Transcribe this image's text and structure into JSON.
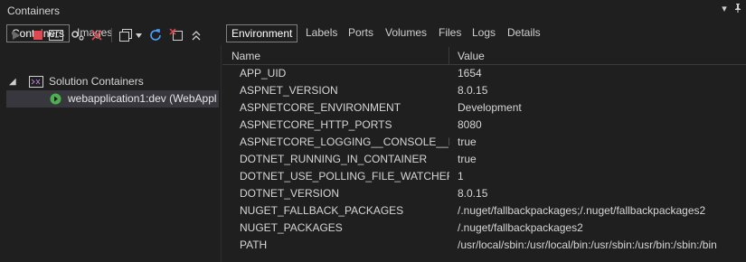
{
  "window": {
    "title": "Containers"
  },
  "left_tabs": [
    {
      "label": "Containers"
    },
    {
      "label": "Images"
    }
  ],
  "tree": {
    "root": "Solution Containers",
    "child": "webapplication1:dev (WebAppl"
  },
  "right_tabs": [
    {
      "label": "Environment"
    },
    {
      "label": "Labels"
    },
    {
      "label": "Ports"
    },
    {
      "label": "Volumes"
    },
    {
      "label": "Files"
    },
    {
      "label": "Logs"
    },
    {
      "label": "Details"
    }
  ],
  "grid": {
    "columns": {
      "name": "Name",
      "value": "Value"
    },
    "rows": [
      {
        "name": "APP_UID",
        "value": "1654"
      },
      {
        "name": "ASPNET_VERSION",
        "value": "8.0.15"
      },
      {
        "name": "ASPNETCORE_ENVIRONMENT",
        "value": "Development"
      },
      {
        "name": "ASPNETCORE_HTTP_PORTS",
        "value": "8080"
      },
      {
        "name": "ASPNETCORE_LOGGING__CONSOLE__DISA...",
        "value": "true"
      },
      {
        "name": "DOTNET_RUNNING_IN_CONTAINER",
        "value": "true"
      },
      {
        "name": "DOTNET_USE_POLLING_FILE_WATCHER",
        "value": "1"
      },
      {
        "name": "DOTNET_VERSION",
        "value": "8.0.15"
      },
      {
        "name": "NUGET_FALLBACK_PACKAGES",
        "value": "/.nuget/fallbackpackages;/.nuget/fallbackpackages2"
      },
      {
        "name": "NUGET_PACKAGES",
        "value": "/.nuget/fallbackpackages2"
      },
      {
        "name": "PATH",
        "value": "/usr/local/sbin:/usr/local/bin:/usr/sbin:/usr/bin:/sbin:/bin"
      }
    ]
  }
}
